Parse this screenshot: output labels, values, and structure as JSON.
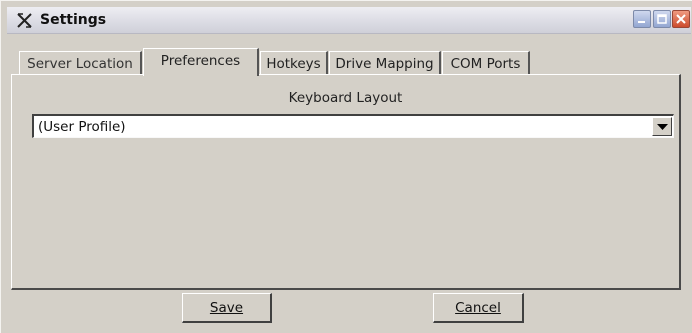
{
  "window": {
    "title": "Settings",
    "app_icon": "x-logo-icon",
    "controls": [
      "minimize-icon",
      "maximize-icon",
      "close-icon"
    ]
  },
  "tabs": [
    {
      "label": "Server Location",
      "active": false
    },
    {
      "label": "Preferences",
      "active": true
    },
    {
      "label": "Hotkeys",
      "active": false
    },
    {
      "label": "Drive Mapping",
      "active": false
    },
    {
      "label": "COM Ports",
      "active": false
    }
  ],
  "preferences": {
    "keyboard_layout_label": "Keyboard Layout",
    "keyboard_layout_value": "(User Profile)",
    "dropdown_icon": "chevron-down-icon"
  },
  "buttons": {
    "save_label": "Save",
    "cancel_label": "Cancel"
  },
  "colors": {
    "background": "#d4d0c8",
    "titlebar": "#dcdce4",
    "close_button": "#cc4c2e",
    "window_button": "#93a6d2"
  }
}
